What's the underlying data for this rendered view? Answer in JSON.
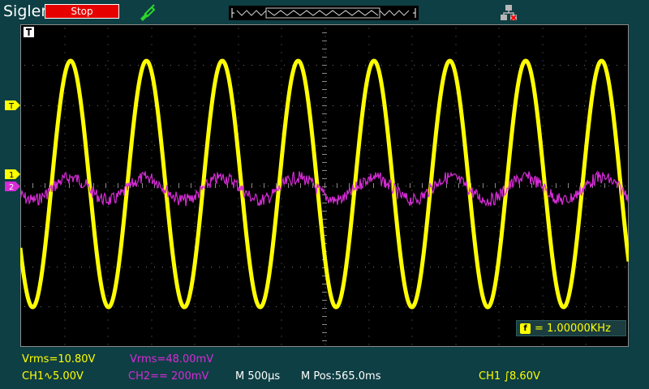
{
  "header": {
    "brand": "Siglent",
    "run_state": "Stop",
    "icons": [
      "probe-icon",
      "timebase-overview",
      "network-icon"
    ]
  },
  "screen": {
    "trigger_tag": "T",
    "ch1_level_marker": "T",
    "ch1_ground_marker": "1",
    "ch2_ground_marker": "2",
    "frequency_counter": "= 1.00000KHz"
  },
  "status": {
    "ch1_measure": "Vrms=10.80V",
    "ch2_measure": "Vrms=48.00mV",
    "ch1_scale": "CH1∿5.00V",
    "ch2_scale": "CH2== 200mV",
    "timebase": "M 500µs",
    "position": "M Pos:565.0ms",
    "trigger": "CH1 ∫8.60V"
  },
  "colors": {
    "ch1": "#ffff00",
    "ch2": "#d62cd6",
    "stop": "#e60000",
    "background": "#0e3f44"
  }
}
